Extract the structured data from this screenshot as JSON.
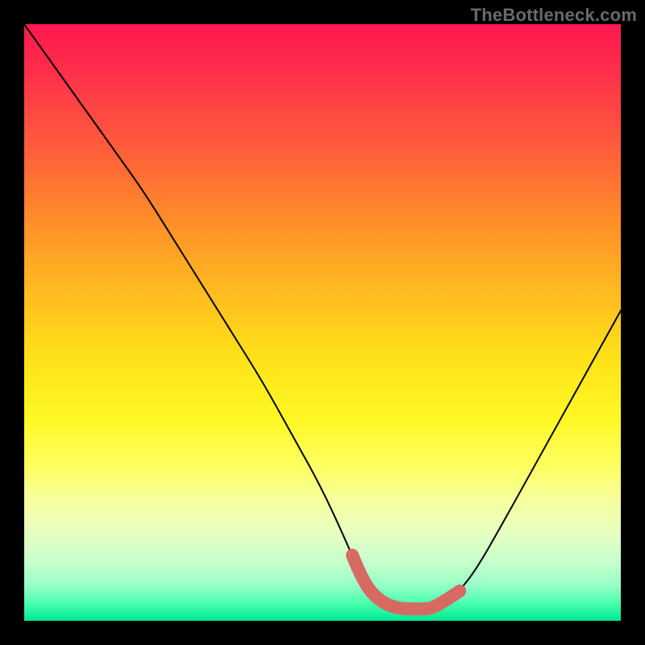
{
  "watermark": "TheBottleneck.com",
  "colors": {
    "frame": "#000000",
    "curve_thin": "#000000",
    "curve_thick": "#d66a63",
    "gradient_top": "#ff1850",
    "gradient_bottom": "#00e890"
  },
  "chart_data": {
    "type": "line",
    "title": "",
    "xlabel": "",
    "ylabel": "",
    "xlim": [
      0,
      100
    ],
    "ylim": [
      0,
      100
    ],
    "series": [
      {
        "name": "curve",
        "x": [
          0,
          5,
          10,
          15,
          20,
          25,
          30,
          35,
          40,
          45,
          50,
          55,
          57,
          60,
          63,
          66,
          68,
          70,
          73,
          76,
          80,
          85,
          90,
          95,
          100
        ],
        "y": [
          100,
          93,
          86,
          79,
          72,
          64,
          56,
          48,
          40,
          31,
          22,
          11,
          6,
          3,
          2,
          2,
          2,
          3,
          5,
          9,
          16,
          25,
          34,
          43,
          52
        ]
      }
    ],
    "highlight_range_x": [
      55,
      73
    ],
    "annotations": []
  }
}
